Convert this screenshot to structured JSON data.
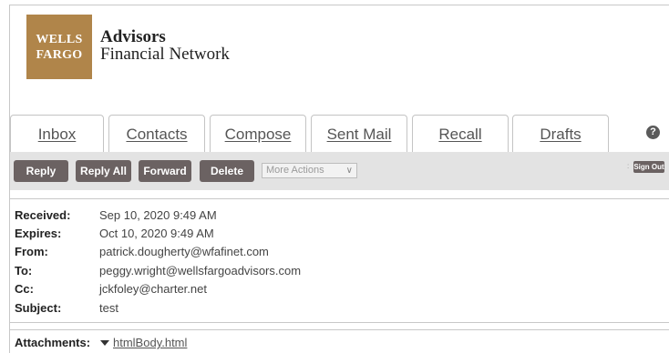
{
  "logo": {
    "line1": "WELLS",
    "line2": "FARGO"
  },
  "brand": {
    "line1": "Advisors",
    "line2": "Financial Network"
  },
  "tabs": [
    {
      "label": "Inbox"
    },
    {
      "label": "Contacts"
    },
    {
      "label": "Compose"
    },
    {
      "label": "Sent Mail"
    },
    {
      "label": "Recall"
    },
    {
      "label": "Drafts"
    }
  ],
  "help_glyph": "?",
  "toolbar": {
    "reply": "Reply",
    "reply_all": "Reply All",
    "forward": "Forward",
    "delete": "Delete",
    "more_actions": "More Actions",
    "sign_out": "Sign Out"
  },
  "message": {
    "received_label": "Received:",
    "received": "Sep 10, 2020 9:49 AM",
    "expires_label": "Expires:",
    "expires": "Oct 10, 2020 9:49 AM",
    "from_label": "From:",
    "from": "patrick.dougherty@wfafinet.com",
    "to_label": "To:",
    "to": "peggy.wright@wellsfargoadvisors.com",
    "cc_label": "Cc:",
    "cc": "jckfoley@charter.net",
    "subject_label": "Subject:",
    "subject": "test"
  },
  "attachments": {
    "label": "Attachments:",
    "file": "htmlBody.html"
  },
  "colors": {
    "logo_bg": "#b0854a",
    "button_bg": "#6b6262",
    "toolbar_bg": "#e3e3e3"
  }
}
